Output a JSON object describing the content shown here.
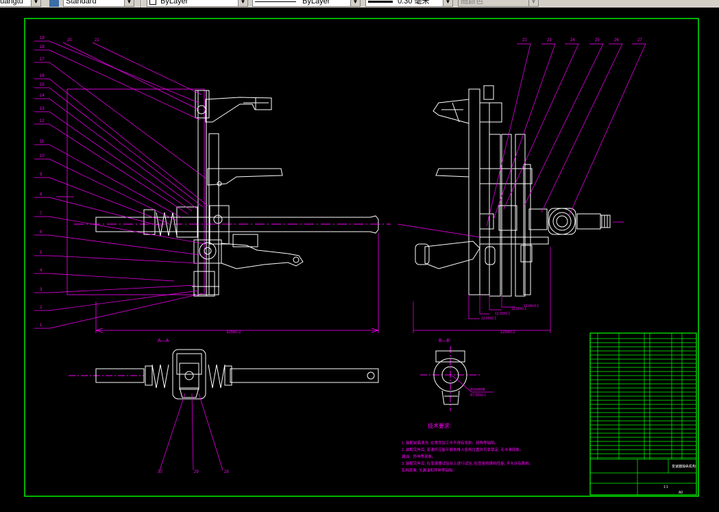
{
  "toolbar": {
    "textstyle": "Standard",
    "textstyle_prefix": "huangtu",
    "layer": "ByLayer",
    "linetype": "ByLayer",
    "lineweight": "0.30 毫米",
    "plotstyle": "随颜色"
  },
  "drawing": {
    "balloons_left": [
      "19",
      "18",
      "17",
      "16",
      "15",
      "14",
      "13",
      "12",
      "11",
      "10",
      "9",
      "8",
      "7",
      "6",
      "5",
      "4",
      "3",
      "2",
      "1"
    ],
    "balloons_top_left": [
      "20",
      "21"
    ],
    "balloons_top_right": [
      "22",
      "23",
      "24",
      "25",
      "26",
      "27"
    ],
    "balloons_bottom": [
      "30",
      "29",
      "28"
    ],
    "section_aa": "A—A",
    "section_bb": "B—B",
    "tech_req_title": "技术要求:",
    "tech_req_lines": [
      "1. 装配前需清洗, 在零件加工中不得有毛刺、锐角等缺陷。",
      "2. 装配完毕后, 变速杆应能平顺地推入各档位置并可靠锁定, 无卡滞现象。",
      "   漏油、异响等现象。",
      "3. 装配完毕后, 在变速器试验台上进行试验, 检查各档换档性能, 不允许有跳档、",
      "   乱档现象, 无漏油和异响等缺陷。"
    ],
    "title_block": {
      "project": "变速器操纵机构",
      "scale": "1:1",
      "sheet": "A0"
    }
  }
}
